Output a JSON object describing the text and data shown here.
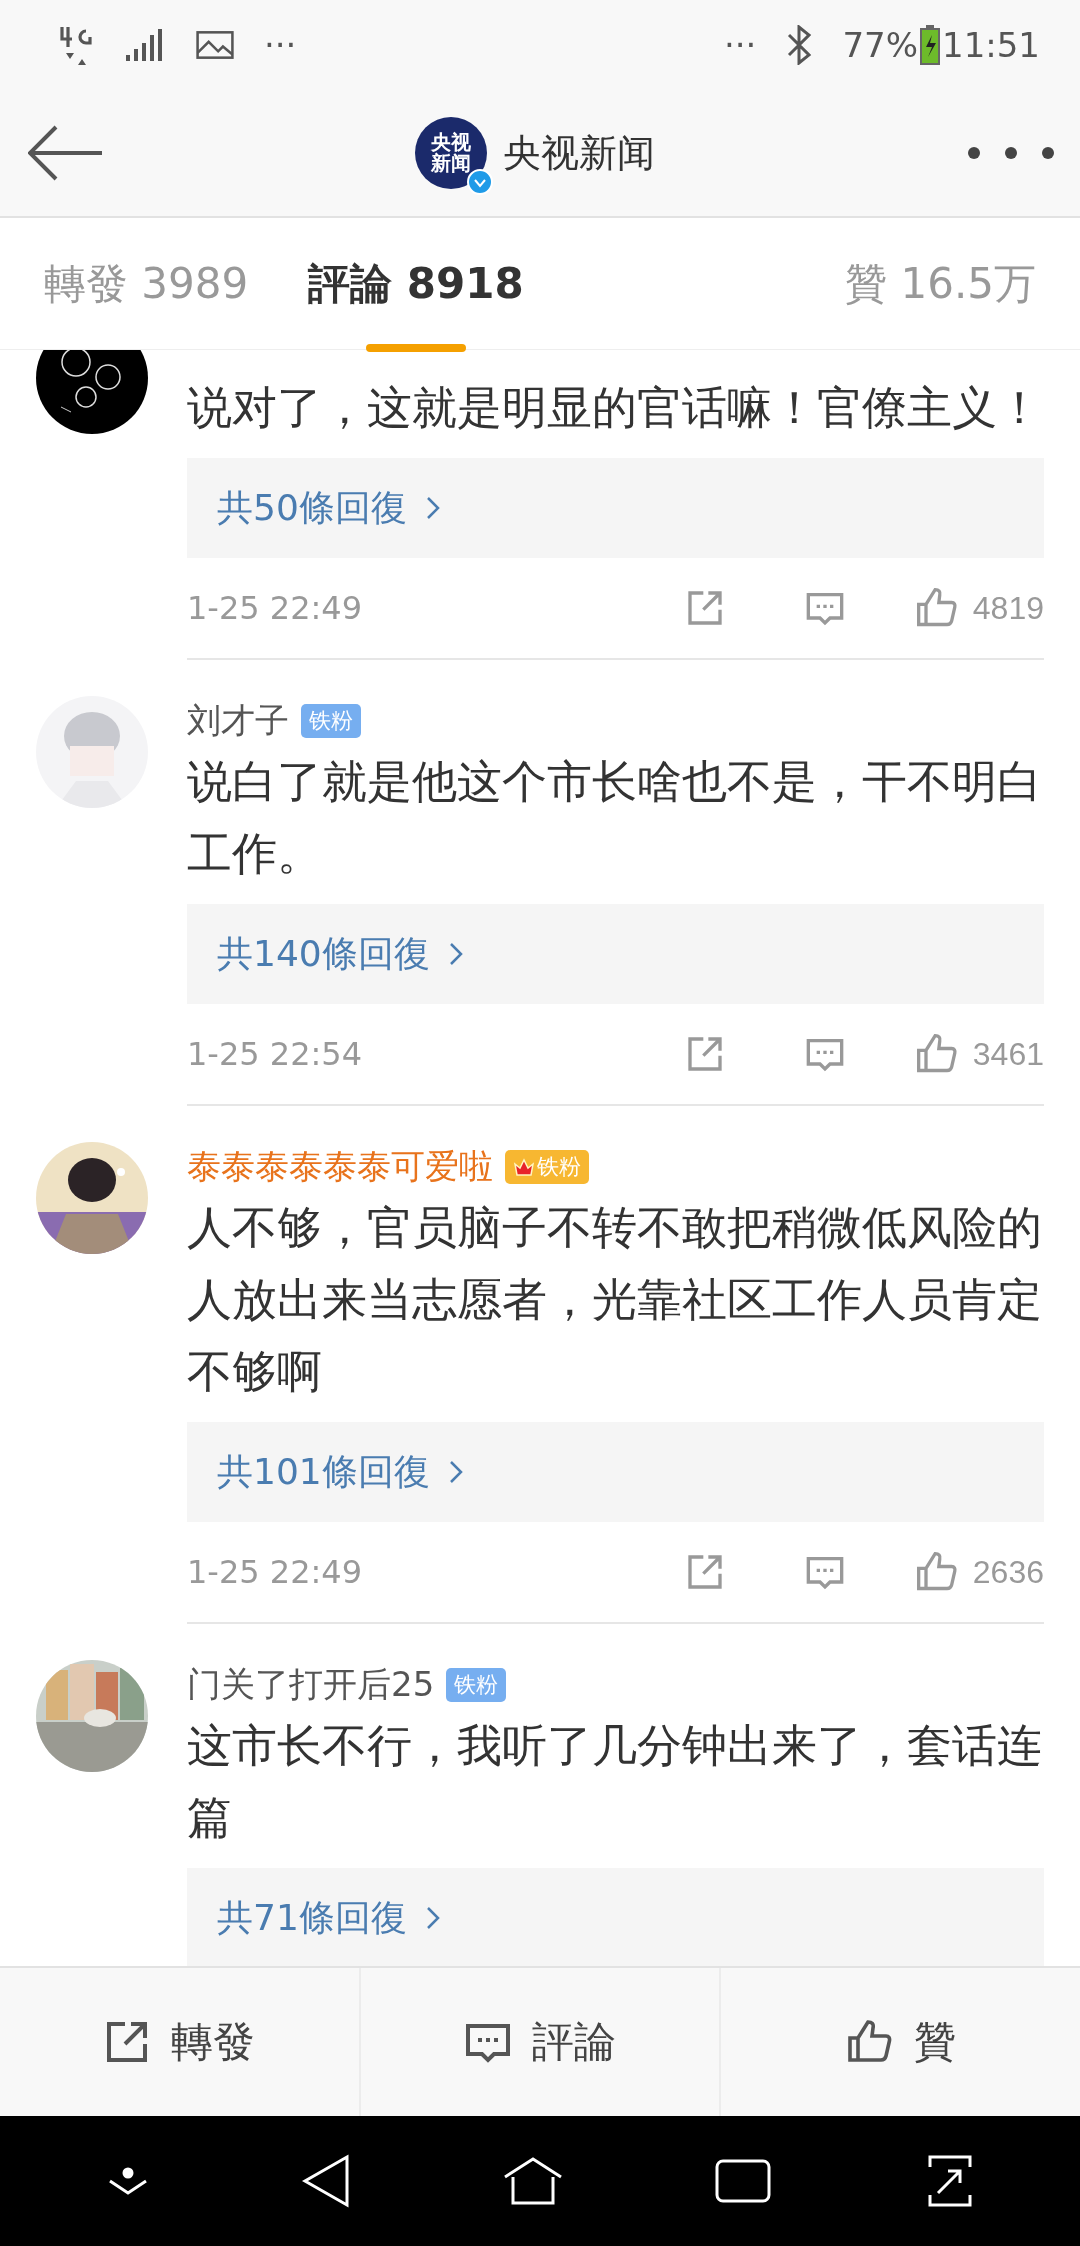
{
  "status_bar": {
    "left_more": "···",
    "right_more": "···",
    "battery": "77%",
    "time": "11:51"
  },
  "header": {
    "logo_text": "央视新闻",
    "title": "央视新闻",
    "verified": true
  },
  "tabs": [
    {
      "label": "轉發 3989",
      "selected": false
    },
    {
      "label": "評論 8918",
      "selected": true
    },
    {
      "label": "贊 16.5万",
      "selected": false
    }
  ],
  "comments": [
    {
      "text": "说对了，这就是明显的官话嘛！官僚主义！",
      "replies": "共50條回復",
      "time": "1-25 22:49",
      "likes": "4819"
    },
    {
      "author": {
        "name": "刘才子",
        "vip": false,
        "badge": {
          "kind": "fan",
          "label": "铁粉"
        }
      },
      "text": "说白了就是他这个市长啥也不是，干不明白工作。",
      "replies": "共140條回復",
      "time": "1-25 22:54",
      "likes": "3461"
    },
    {
      "author": {
        "name": "泰泰泰泰泰泰可爱啦",
        "vip": true,
        "badge": {
          "kind": "crown_fan",
          "label": "铁粉"
        }
      },
      "text": "人不够，官员脑子不转不敢把稍微低风险的人放出来当志愿者，光靠社区工作人员肯定不够啊",
      "replies": "共101條回復",
      "time": "1-25 22:49",
      "likes": "2636"
    },
    {
      "author": {
        "name": "门关了打开后25",
        "vip": false,
        "badge": {
          "kind": "fan",
          "label": "铁粉"
        }
      },
      "text": "这市长不行，我听了几分钟出来了，套话连篇",
      "replies": "共71條回復"
    }
  ],
  "bottom_bar": [
    {
      "kind": "share",
      "label": "轉發"
    },
    {
      "kind": "comment",
      "label": "評論"
    },
    {
      "kind": "like",
      "label": "贊"
    }
  ]
}
